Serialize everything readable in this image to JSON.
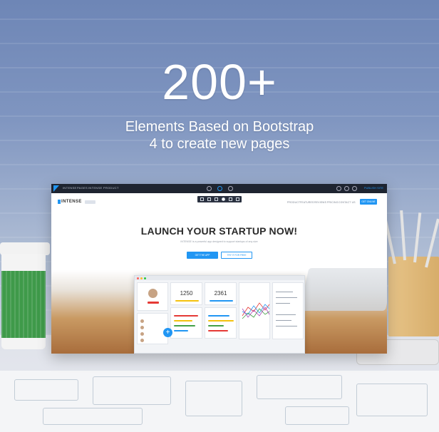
{
  "hero": {
    "title": "200+",
    "subtitle_line1": "Elements Based on Bootstrap",
    "subtitle_line2": "4 to create new pages"
  },
  "editor": {
    "breadcrumb": [
      "INTENSE",
      "PAGES",
      "INTENSE PRODUCT"
    ],
    "publish_label": "PUBLISH SITE"
  },
  "site": {
    "logo": "INTENSE",
    "nav": [
      "PRODUCT",
      "FEATURES",
      "REVIEWS",
      "PRICING",
      "CONTACT US"
    ],
    "nav_button": "GET ONLINE",
    "headline": "LAUNCH YOUR STARTUP NOW!",
    "tagline": "INTENSE is a powerful app designed to support startups of any size",
    "primary_button": "GET THE APP",
    "secondary_button": "TRY IT FOR FREE"
  },
  "dashboard": {
    "stat1": "1250",
    "stat2": "2361"
  },
  "colors": {
    "accent": "#2196f3",
    "editor_bar": "#1e2430"
  }
}
